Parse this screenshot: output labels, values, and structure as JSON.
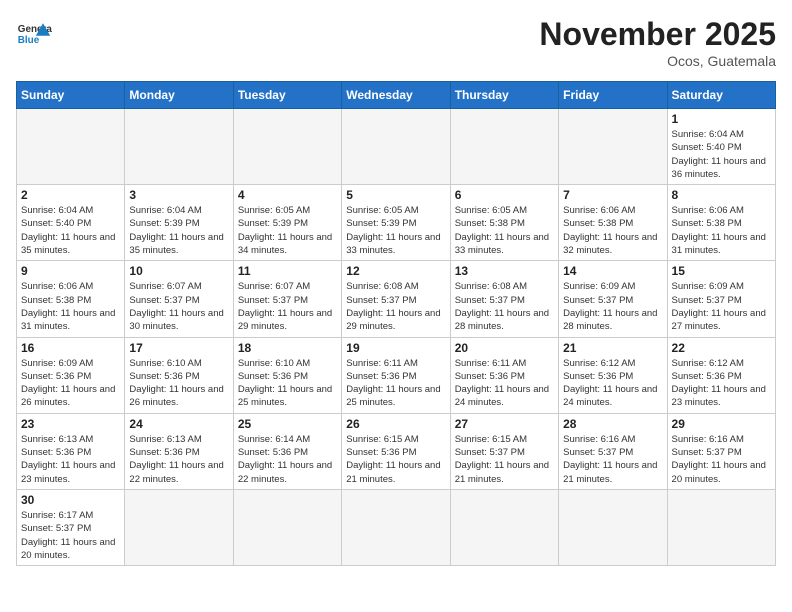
{
  "header": {
    "logo_general": "General",
    "logo_blue": "Blue",
    "month_title": "November 2025",
    "location": "Ocos, Guatemala"
  },
  "weekdays": [
    "Sunday",
    "Monday",
    "Tuesday",
    "Wednesday",
    "Thursday",
    "Friday",
    "Saturday"
  ],
  "days": [
    {
      "num": "",
      "sunrise": "",
      "sunset": "",
      "daylight": ""
    },
    {
      "num": "",
      "sunrise": "",
      "sunset": "",
      "daylight": ""
    },
    {
      "num": "",
      "sunrise": "",
      "sunset": "",
      "daylight": ""
    },
    {
      "num": "",
      "sunrise": "",
      "sunset": "",
      "daylight": ""
    },
    {
      "num": "",
      "sunrise": "",
      "sunset": "",
      "daylight": ""
    },
    {
      "num": "",
      "sunrise": "",
      "sunset": "",
      "daylight": ""
    },
    {
      "num": "1",
      "sunrise": "Sunrise: 6:04 AM",
      "sunset": "Sunset: 5:40 PM",
      "daylight": "Daylight: 11 hours and 36 minutes."
    },
    {
      "num": "2",
      "sunrise": "Sunrise: 6:04 AM",
      "sunset": "Sunset: 5:40 PM",
      "daylight": "Daylight: 11 hours and 35 minutes."
    },
    {
      "num": "3",
      "sunrise": "Sunrise: 6:04 AM",
      "sunset": "Sunset: 5:39 PM",
      "daylight": "Daylight: 11 hours and 35 minutes."
    },
    {
      "num": "4",
      "sunrise": "Sunrise: 6:05 AM",
      "sunset": "Sunset: 5:39 PM",
      "daylight": "Daylight: 11 hours and 34 minutes."
    },
    {
      "num": "5",
      "sunrise": "Sunrise: 6:05 AM",
      "sunset": "Sunset: 5:39 PM",
      "daylight": "Daylight: 11 hours and 33 minutes."
    },
    {
      "num": "6",
      "sunrise": "Sunrise: 6:05 AM",
      "sunset": "Sunset: 5:38 PM",
      "daylight": "Daylight: 11 hours and 33 minutes."
    },
    {
      "num": "7",
      "sunrise": "Sunrise: 6:06 AM",
      "sunset": "Sunset: 5:38 PM",
      "daylight": "Daylight: 11 hours and 32 minutes."
    },
    {
      "num": "8",
      "sunrise": "Sunrise: 6:06 AM",
      "sunset": "Sunset: 5:38 PM",
      "daylight": "Daylight: 11 hours and 31 minutes."
    },
    {
      "num": "9",
      "sunrise": "Sunrise: 6:06 AM",
      "sunset": "Sunset: 5:38 PM",
      "daylight": "Daylight: 11 hours and 31 minutes."
    },
    {
      "num": "10",
      "sunrise": "Sunrise: 6:07 AM",
      "sunset": "Sunset: 5:37 PM",
      "daylight": "Daylight: 11 hours and 30 minutes."
    },
    {
      "num": "11",
      "sunrise": "Sunrise: 6:07 AM",
      "sunset": "Sunset: 5:37 PM",
      "daylight": "Daylight: 11 hours and 29 minutes."
    },
    {
      "num": "12",
      "sunrise": "Sunrise: 6:08 AM",
      "sunset": "Sunset: 5:37 PM",
      "daylight": "Daylight: 11 hours and 29 minutes."
    },
    {
      "num": "13",
      "sunrise": "Sunrise: 6:08 AM",
      "sunset": "Sunset: 5:37 PM",
      "daylight": "Daylight: 11 hours and 28 minutes."
    },
    {
      "num": "14",
      "sunrise": "Sunrise: 6:09 AM",
      "sunset": "Sunset: 5:37 PM",
      "daylight": "Daylight: 11 hours and 28 minutes."
    },
    {
      "num": "15",
      "sunrise": "Sunrise: 6:09 AM",
      "sunset": "Sunset: 5:37 PM",
      "daylight": "Daylight: 11 hours and 27 minutes."
    },
    {
      "num": "16",
      "sunrise": "Sunrise: 6:09 AM",
      "sunset": "Sunset: 5:36 PM",
      "daylight": "Daylight: 11 hours and 26 minutes."
    },
    {
      "num": "17",
      "sunrise": "Sunrise: 6:10 AM",
      "sunset": "Sunset: 5:36 PM",
      "daylight": "Daylight: 11 hours and 26 minutes."
    },
    {
      "num": "18",
      "sunrise": "Sunrise: 6:10 AM",
      "sunset": "Sunset: 5:36 PM",
      "daylight": "Daylight: 11 hours and 25 minutes."
    },
    {
      "num": "19",
      "sunrise": "Sunrise: 6:11 AM",
      "sunset": "Sunset: 5:36 PM",
      "daylight": "Daylight: 11 hours and 25 minutes."
    },
    {
      "num": "20",
      "sunrise": "Sunrise: 6:11 AM",
      "sunset": "Sunset: 5:36 PM",
      "daylight": "Daylight: 11 hours and 24 minutes."
    },
    {
      "num": "21",
      "sunrise": "Sunrise: 6:12 AM",
      "sunset": "Sunset: 5:36 PM",
      "daylight": "Daylight: 11 hours and 24 minutes."
    },
    {
      "num": "22",
      "sunrise": "Sunrise: 6:12 AM",
      "sunset": "Sunset: 5:36 PM",
      "daylight": "Daylight: 11 hours and 23 minutes."
    },
    {
      "num": "23",
      "sunrise": "Sunrise: 6:13 AM",
      "sunset": "Sunset: 5:36 PM",
      "daylight": "Daylight: 11 hours and 23 minutes."
    },
    {
      "num": "24",
      "sunrise": "Sunrise: 6:13 AM",
      "sunset": "Sunset: 5:36 PM",
      "daylight": "Daylight: 11 hours and 22 minutes."
    },
    {
      "num": "25",
      "sunrise": "Sunrise: 6:14 AM",
      "sunset": "Sunset: 5:36 PM",
      "daylight": "Daylight: 11 hours and 22 minutes."
    },
    {
      "num": "26",
      "sunrise": "Sunrise: 6:15 AM",
      "sunset": "Sunset: 5:36 PM",
      "daylight": "Daylight: 11 hours and 21 minutes."
    },
    {
      "num": "27",
      "sunrise": "Sunrise: 6:15 AM",
      "sunset": "Sunset: 5:37 PM",
      "daylight": "Daylight: 11 hours and 21 minutes."
    },
    {
      "num": "28",
      "sunrise": "Sunrise: 6:16 AM",
      "sunset": "Sunset: 5:37 PM",
      "daylight": "Daylight: 11 hours and 21 minutes."
    },
    {
      "num": "29",
      "sunrise": "Sunrise: 6:16 AM",
      "sunset": "Sunset: 5:37 PM",
      "daylight": "Daylight: 11 hours and 20 minutes."
    },
    {
      "num": "30",
      "sunrise": "Sunrise: 6:17 AM",
      "sunset": "Sunset: 5:37 PM",
      "daylight": "Daylight: 11 hours and 20 minutes."
    }
  ]
}
